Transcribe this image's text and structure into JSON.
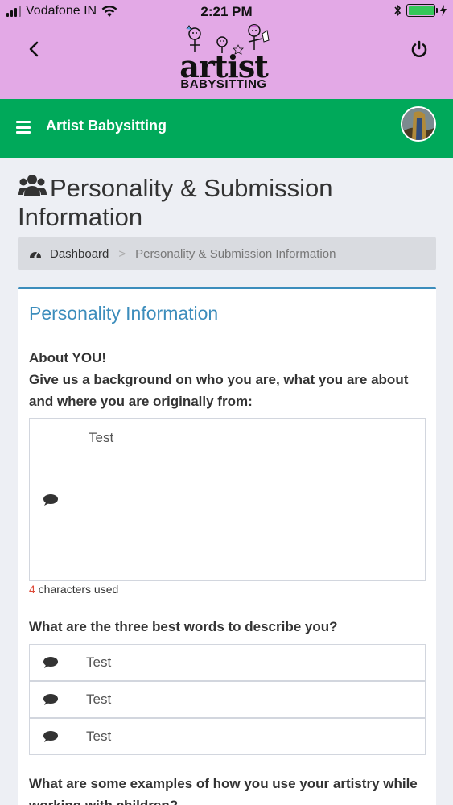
{
  "status_bar": {
    "carrier": "Vodafone IN",
    "time": "2:21 PM"
  },
  "header": {
    "logo_word": "artist",
    "logo_sub": "BABYSITTING"
  },
  "appbar": {
    "title": "Artist Babysitting"
  },
  "page": {
    "title": "Personality & Submission Information"
  },
  "breadcrumb": {
    "home": "Dashboard",
    "separator": ">",
    "current": "Personality & Submission Information"
  },
  "card": {
    "title": "Personality Information",
    "q1_line1": "About YOU!",
    "q1_line2": "Give us a background on who you are, what you are about and where you are originally from:",
    "about_value": "Test",
    "counter_num": "4",
    "counter_text": " characters used",
    "q2": "What are the three best words to describe you?",
    "words": [
      "Test",
      "Test",
      "Test"
    ],
    "q3": "What are some examples of how you use your artistry while working with children?"
  },
  "colors": {
    "header_bg": "#e3a9e6",
    "appbar_bg": "#00a95a",
    "accent": "#3c8dbc",
    "counter_red": "#dd4b39"
  }
}
